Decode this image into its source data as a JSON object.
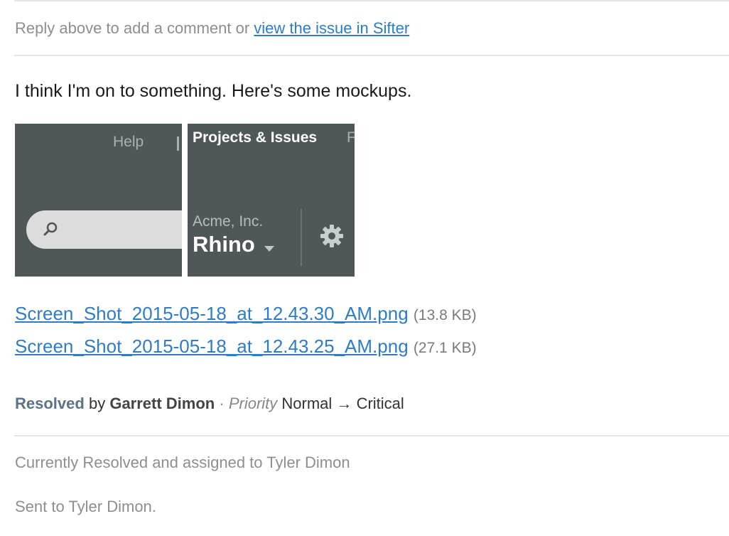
{
  "header": {
    "reply_text": "Reply above to add a comment or ",
    "issue_link": "view the issue in Sifter"
  },
  "comment": {
    "text": "I think I'm on to something. Here's some mockups."
  },
  "thumb_left": {
    "help": "Help"
  },
  "thumb_right": {
    "nav_title": "Projects & Issues",
    "company": "Acme, Inc.",
    "project": "Rhino"
  },
  "attachments": [
    {
      "filename": "Screen_Shot_2015-05-18_at_12.43.30_AM.png",
      "size": "(13.8 KB)"
    },
    {
      "filename": "Screen_Shot_2015-05-18_at_12.43.25_AM.png",
      "size": "(27.1 KB)"
    }
  ],
  "status_change": {
    "status": "Resolved",
    "by": "by",
    "user": "Garrett Dimon",
    "separator": "·",
    "field": "Priority",
    "from": "Normal",
    "arrow": "→",
    "to": "Critical"
  },
  "footer": {
    "current": "Currently Resolved and assigned to Tyler Dimon",
    "sent": "Sent to Tyler Dimon."
  },
  "colors": {
    "link": "#2e7cc6",
    "thumb_bg": "#4f5759",
    "resolved": "#5b7384"
  }
}
